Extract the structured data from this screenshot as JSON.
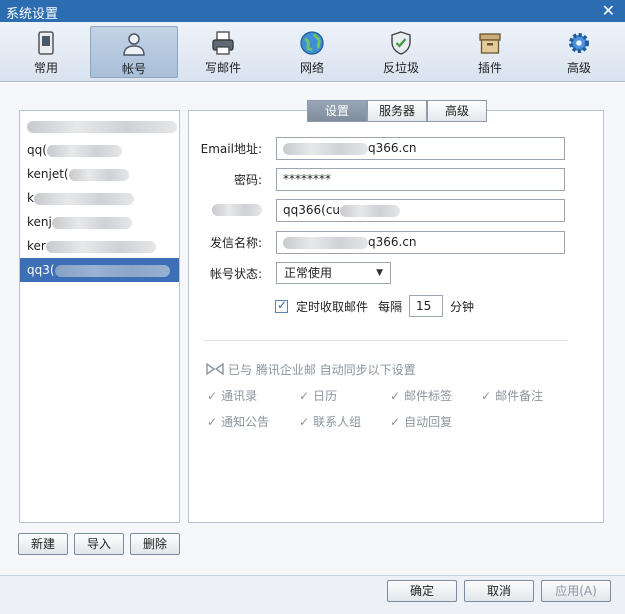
{
  "window": {
    "title": "系统设置",
    "close_label": "✕"
  },
  "toolbar": {
    "items": [
      {
        "label": "常用"
      },
      {
        "label": "帐号"
      },
      {
        "label": "写邮件"
      },
      {
        "label": "网络"
      },
      {
        "label": "反垃圾"
      },
      {
        "label": "插件"
      },
      {
        "label": "高级"
      }
    ]
  },
  "accounts": {
    "items": [
      {
        "label": ""
      },
      {
        "label": "qq("
      },
      {
        "label": "kenjet("
      },
      {
        "label": "k"
      },
      {
        "label": "kenj"
      },
      {
        "label": "ker"
      },
      {
        "label": "qq3("
      }
    ]
  },
  "list_buttons": {
    "new": "新建",
    "import": "导入",
    "delete": "删除"
  },
  "tabs": [
    {
      "label": "设置"
    },
    {
      "label": "服务器"
    },
    {
      "label": "高级"
    }
  ],
  "form": {
    "email_label": "Email地址:",
    "email_value": "q366.cn",
    "password_label": "密码:",
    "password_value": "********",
    "name_value": "qq366(cu",
    "sender_label": "发信名称:",
    "sender_value": "q366.cn",
    "status_label": "帐号状态:",
    "status_value": "正常使用",
    "timer_label": "定时收取邮件",
    "every_label": "每隔",
    "interval_value": "15",
    "minutes_label": "分钟"
  },
  "sync": {
    "title": "已与 腾讯企业邮 自动同步以下设置",
    "items": [
      {
        "label": "通讯录"
      },
      {
        "label": "日历"
      },
      {
        "label": "邮件标签"
      },
      {
        "label": "邮件备注"
      },
      {
        "label": "通知公告"
      },
      {
        "label": "联系人组"
      },
      {
        "label": "自动回复"
      }
    ]
  },
  "footer": {
    "ok": "确定",
    "cancel": "取消",
    "apply": "应用(A)"
  },
  "colors": {
    "titlebar": "#2c6cb0",
    "selection": "#3c6fb5"
  }
}
